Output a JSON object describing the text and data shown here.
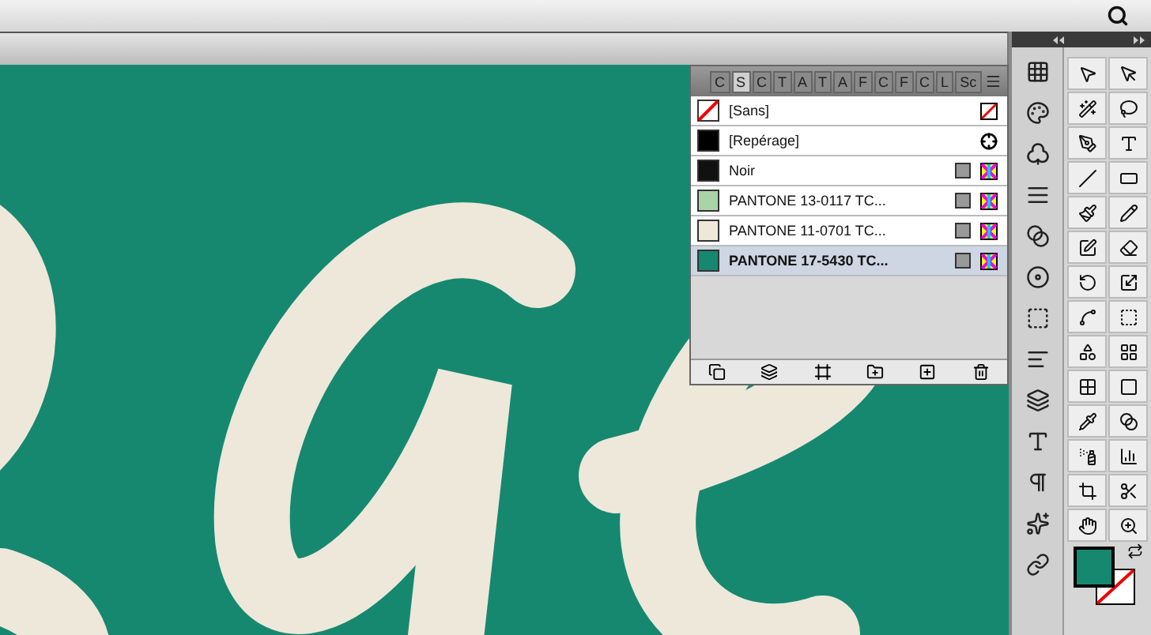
{
  "panel": {
    "tabs": [
      {
        "label": "C",
        "selected": false
      },
      {
        "label": "S",
        "selected": true
      },
      {
        "label": "C",
        "selected": false
      },
      {
        "label": "T",
        "selected": false
      },
      {
        "label": "A",
        "selected": false
      },
      {
        "label": "T",
        "selected": false
      },
      {
        "label": "A",
        "selected": false
      },
      {
        "label": "F",
        "selected": false
      },
      {
        "label": "C",
        "selected": false
      },
      {
        "label": "F",
        "selected": false
      },
      {
        "label": "C",
        "selected": false
      },
      {
        "label": "L",
        "selected": false
      },
      {
        "label": "Sc",
        "selected": false
      }
    ],
    "swatches": [
      {
        "name": "[Sans]",
        "kind": "none",
        "selected": false
      },
      {
        "name": "[Repérage]",
        "kind": "registration",
        "color": "#000000",
        "selected": false
      },
      {
        "name": "Noir",
        "kind": "process",
        "color": "#111111",
        "selected": false
      },
      {
        "name": "PANTONE 13-0117 TC...",
        "kind": "process",
        "color": "#a8d4a8",
        "selected": false
      },
      {
        "name": "PANTONE 11-0701 TC...",
        "kind": "process",
        "color": "#ede8da",
        "selected": false
      },
      {
        "name": "PANTONE 17-5430 TC...",
        "kind": "process",
        "color": "#168870",
        "selected": true
      }
    ]
  }
}
